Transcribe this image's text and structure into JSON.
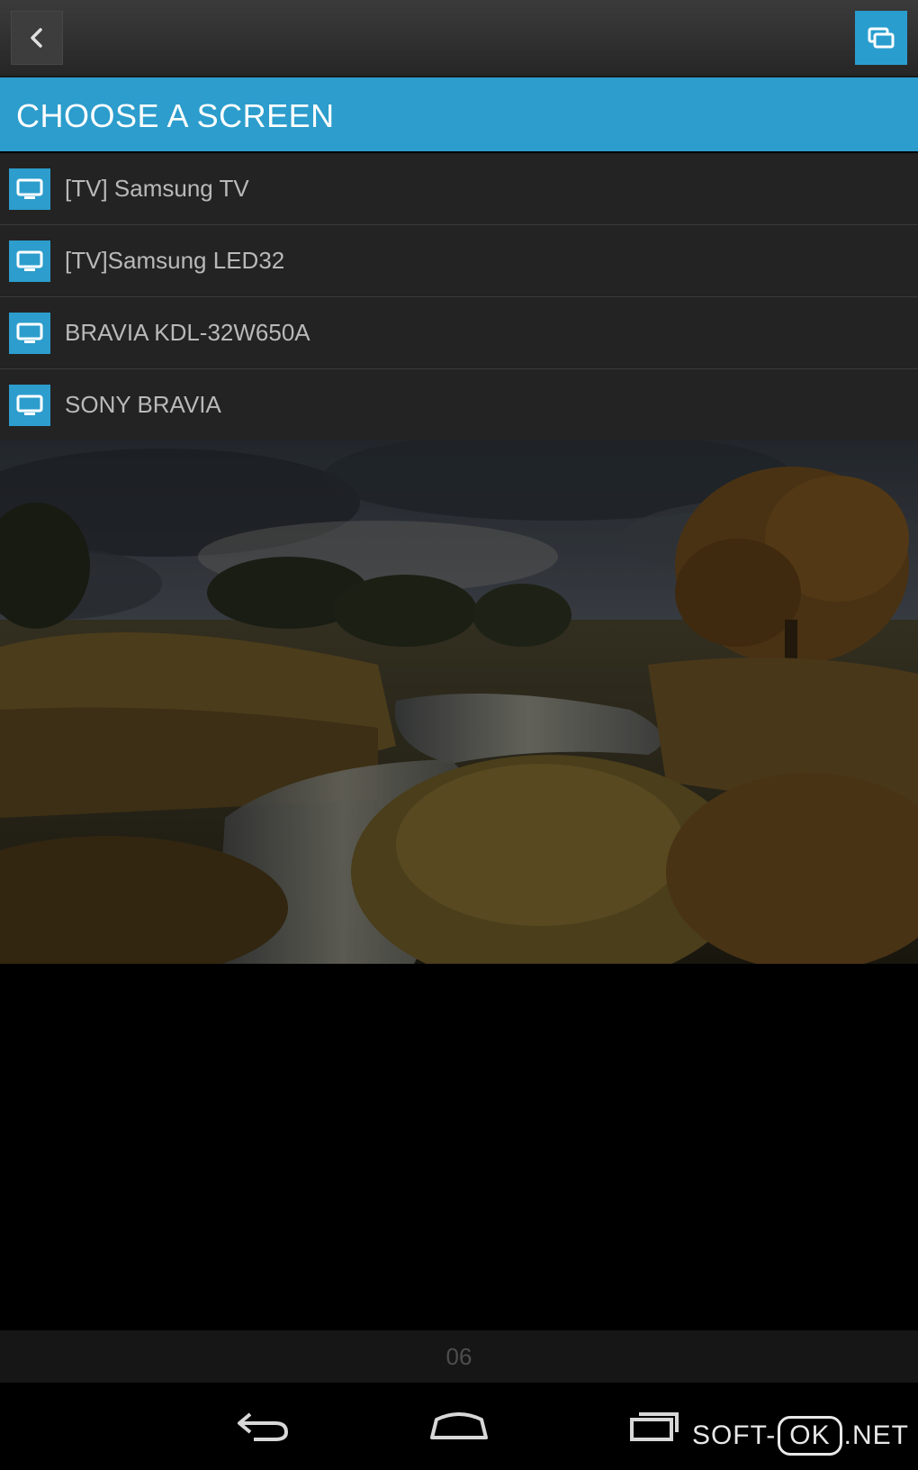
{
  "toolbar": {
    "back_icon": "chevron-left-icon",
    "cast_icon": "screens-icon"
  },
  "header": {
    "title": "CHOOSE A SCREEN"
  },
  "screens": [
    {
      "label": "[TV] Samsung TV",
      "icon": "tv-icon"
    },
    {
      "label": "[TV]Samsung LED32",
      "icon": "tv-icon"
    },
    {
      "label": "BRAVIA KDL-32W650A",
      "icon": "tv-icon"
    },
    {
      "label": "SONY BRAVIA",
      "icon": "tv-icon"
    }
  ],
  "viewer": {
    "page_counter": "06"
  },
  "navbar": {
    "back": "back-icon",
    "home": "home-icon",
    "recents": "recents-icon"
  },
  "watermark": {
    "left": "SOFT-",
    "box": "OK",
    "right": ".NET"
  },
  "colors": {
    "accent": "#2c9dcc",
    "row_bg": "#232323",
    "topbar": "#333333"
  }
}
